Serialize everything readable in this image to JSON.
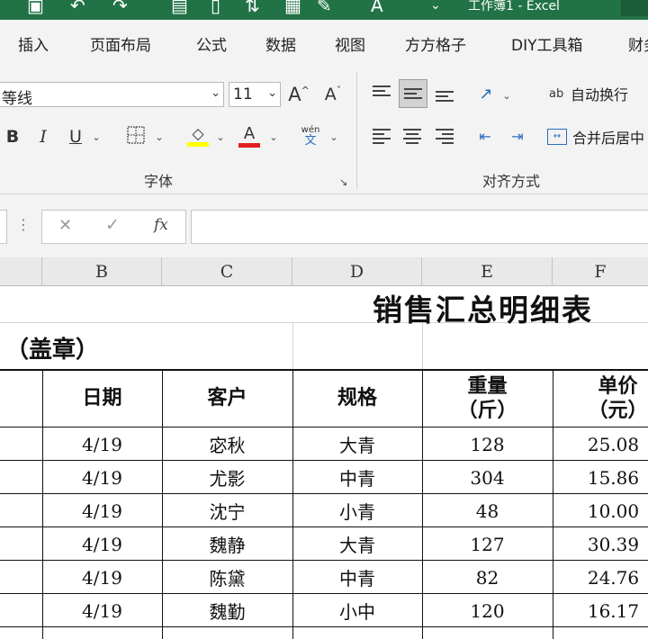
{
  "window": {
    "title": "工作簿1 - Excel"
  },
  "tabs": [
    "插入",
    "页面布局",
    "公式",
    "数据",
    "视图",
    "方方格子",
    "DIY工具箱",
    "财务"
  ],
  "ribbon": {
    "font_name": "等线",
    "font_size": "11",
    "grow_font": "A",
    "shrink_font": "A",
    "bold": "B",
    "italic": "I",
    "underline": "U",
    "font_color_glyph": "A",
    "phonetic_top": "wén",
    "phonetic_bottom": "文",
    "wrap_text_label": "自动换行",
    "wrap_text_glyph": "ab",
    "merge_center_label": "合并后居中",
    "group_font": "字体",
    "group_alignment": "对齐方式",
    "fill_color": "#ffff00",
    "font_color": "#e02020"
  },
  "formula_bar": {
    "cancel": "✕",
    "enter": "✓",
    "fx": "fx",
    "value": ""
  },
  "columns": [
    "B",
    "C",
    "D",
    "E",
    "F"
  ],
  "sheet": {
    "title": "销售汇总明细表",
    "stamp_label": "（盖章）",
    "headers": {
      "date": "日期",
      "customer": "客户",
      "spec": "规格",
      "weight_1": "重量",
      "weight_2": "（斤）",
      "price_1": "单价",
      "price_2": "（元）"
    },
    "rows": [
      {
        "date": "4/19",
        "customer": "宓秋",
        "spec": "大青",
        "weight": "128",
        "price": "25.08"
      },
      {
        "date": "4/19",
        "customer": "尤影",
        "spec": "中青",
        "weight": "304",
        "price": "15.86"
      },
      {
        "date": "4/19",
        "customer": "沈宁",
        "spec": "小青",
        "weight": "48",
        "price": "10.00"
      },
      {
        "date": "4/19",
        "customer": "魏静",
        "spec": "大青",
        "weight": "127",
        "price": "30.39"
      },
      {
        "date": "4/19",
        "customer": "陈黛",
        "spec": "中青",
        "weight": "82",
        "price": "24.76"
      },
      {
        "date": "4/19",
        "customer": "魏勤",
        "spec": "小中",
        "weight": "120",
        "price": "16.17"
      }
    ]
  }
}
